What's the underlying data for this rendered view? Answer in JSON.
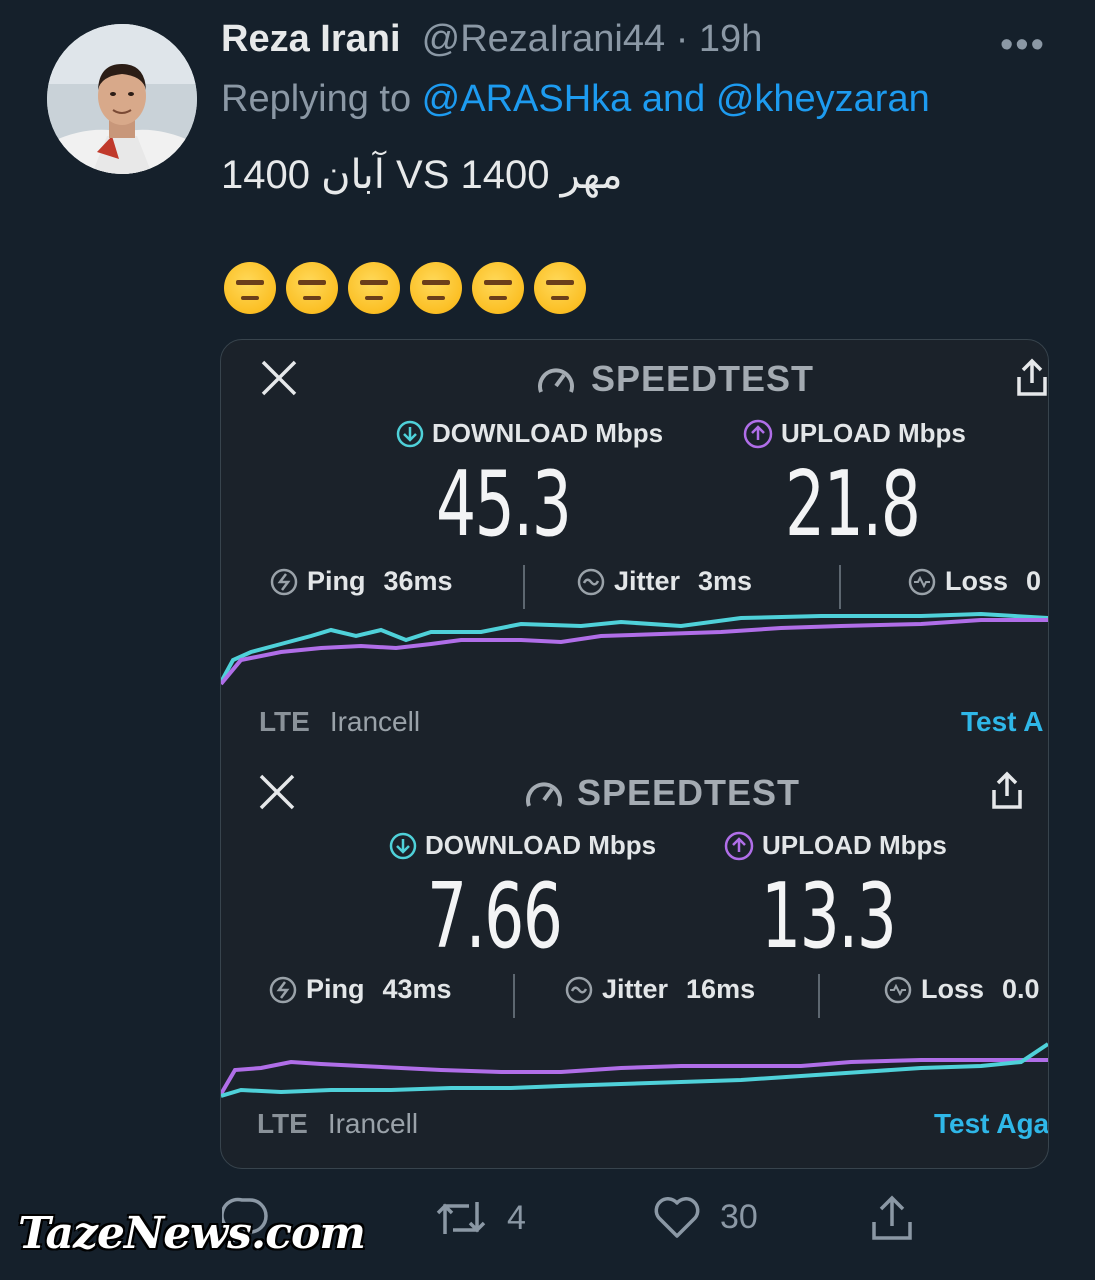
{
  "tweet": {
    "author_name": "Reza Irani",
    "author_handle": "@RezaIrani44",
    "separator": " · ",
    "time": "19h",
    "more_glyph": "•••",
    "replying_prefix": "Replying to ",
    "replying_mentions": "@ARASHka and @kheyzaran",
    "text": "مهر 1400 VS آبان 1400",
    "emojis": [
      "😑",
      "😑",
      "😑",
      "😑",
      "😑",
      "😑"
    ]
  },
  "speedtest_1": {
    "title": "SPEEDTEST",
    "download_label": "DOWNLOAD Mbps",
    "upload_label": "UPLOAD Mbps",
    "download_value": "45.3",
    "upload_value": "21.8",
    "ping_label": "Ping",
    "ping_value": "36ms",
    "jitter_label": "Jitter",
    "jitter_value": "3ms",
    "loss_label": "Loss",
    "loss_value": "0",
    "network": "LTE",
    "carrier": "Irancell",
    "test_again": "Test A"
  },
  "speedtest_2": {
    "title": "SPEEDTEST",
    "download_label": "DOWNLOAD Mbps",
    "upload_label": "UPLOAD Mbps",
    "download_value": "7.66",
    "upload_value": "13.3",
    "ping_label": "Ping",
    "ping_value": "43ms",
    "jitter_label": "Jitter",
    "jitter_value": "16ms",
    "loss_label": "Loss",
    "loss_value": "0.0",
    "network": "LTE",
    "carrier": "Irancell",
    "test_again": "Test Aga"
  },
  "actions": {
    "retweets": "4",
    "likes": "30"
  },
  "watermark": "TazeNews.com",
  "colors": {
    "background": "#15202b",
    "accent": "#1d9bf0",
    "download_line": "#4fd1d9",
    "upload_line": "#b06ee8"
  }
}
